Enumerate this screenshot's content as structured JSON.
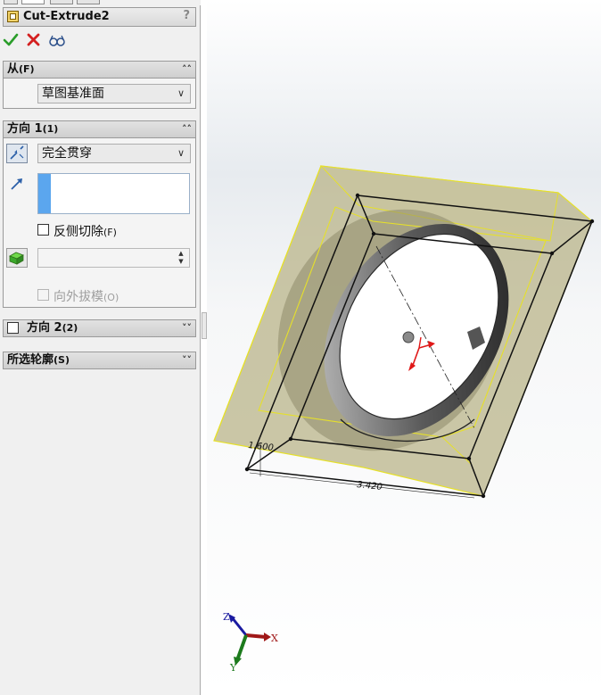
{
  "feature": {
    "title": "Cut-Extrude2",
    "help": "?"
  },
  "actions": {
    "ok_icon": "check-icon",
    "cancel_icon": "x-icon",
    "preview_icon": "glasses-icon"
  },
  "from_group": {
    "title": "从",
    "title_suffix": "(F)",
    "start_condition": "草图基准面"
  },
  "direction1": {
    "title": "方向 1",
    "title_suffix": "(1)",
    "end_condition": "完全贯穿",
    "flip_side_label": "反侧切除",
    "flip_side_suffix": "(F)",
    "draft_outward_label": "向外拔模",
    "draft_outward_suffix": "(O)"
  },
  "direction2": {
    "title": "方向 2",
    "title_suffix": "(2)"
  },
  "selected_contours": {
    "title": "所选轮廓",
    "title_suffix": "(S)"
  },
  "viewport": {
    "dim_width": "3.420",
    "dim_side": "1.600",
    "triad": {
      "x": "X",
      "y": "Y",
      "z": "Z"
    }
  },
  "colors": {
    "preview_fill": "#b9b48a",
    "preview_edge": "#e6e02a",
    "ok_green": "#2a9d2a",
    "cancel_red": "#d42020",
    "selection_accent": "#5ba6ee"
  }
}
